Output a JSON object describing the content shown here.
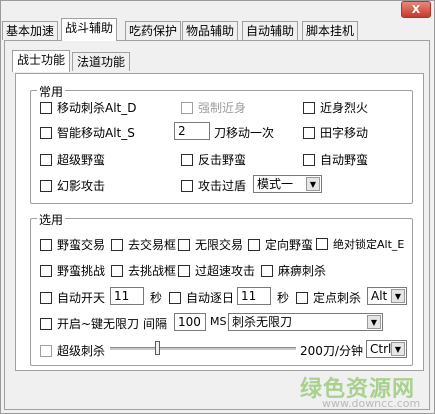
{
  "window": {
    "close_label": "X"
  },
  "main_tabs": [
    "基本加速",
    "战斗辅助",
    "吃药保护",
    "物品辅助",
    "自动辅助",
    "脚本挂机"
  ],
  "sub_tabs": [
    "战士功能",
    "法道功能"
  ],
  "groups": {
    "common_title": "常用",
    "options_title": "选用"
  },
  "common": {
    "move_stab": "移动刺杀Alt_D",
    "force_close": "强制近身",
    "close_fire": "近身烈火",
    "smart_move": "智能移动Alt_S",
    "move_value": "2",
    "move_once": "刀移动一次",
    "tian_move": "田字移动",
    "super_savage": "超级野蛮",
    "counter_savage": "反击野蛮",
    "auto_savage": "自动野蛮",
    "phantom_strike": "幻影攻击",
    "attack_shield": "攻击过盾",
    "mode_select": "模式一"
  },
  "options": {
    "savage_trade": "野蛮交易",
    "remove_trade_box": "去交易框",
    "unlimited_trade": "无限交易",
    "directional_savage": "定向野蛮",
    "absolute_lock": "绝对锁定Alt_E",
    "savage_challenge": "野蛮挑战",
    "remove_challenge_box": "去挑战框",
    "overspeed_attack": "过超速攻击",
    "paralyze_stab": "麻痹刺杀",
    "auto_open_sky": "自动开天",
    "open_sky_value": "11",
    "unit_sec_1": "秒",
    "auto_chase_sun": "自动逐日",
    "chase_sun_value": "11",
    "unit_sec_2": "秒",
    "fixed_stab": "定点刺杀",
    "fixed_stab_key": "Alt",
    "one_key_unlimited": "开启~键无限刀",
    "interval_label": "间隔",
    "interval_value": "100",
    "interval_unit": "MS",
    "blade_mode": "刺杀无限刀",
    "super_stab": "超级刺杀",
    "speed_label": "200刀/分钟",
    "speed_key": "Ctrl"
  },
  "slider": {
    "level_fraction": 0.25
  },
  "watermark": {
    "cn": "绿色资源网",
    "url": "www.downcc.com"
  },
  "colors": {
    "watermark": "#a9d08e",
    "disabled_text": "#a0a0a0"
  }
}
